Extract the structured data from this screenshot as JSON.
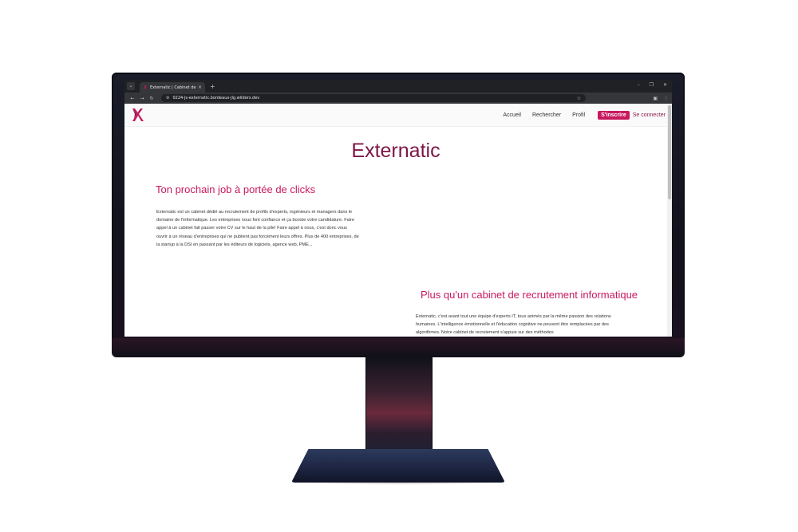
{
  "browser": {
    "tab_title": "Externatic | Cabinet de recrutement",
    "tab_close": "×",
    "new_tab": "+",
    "url": "0224-js-externatic.bordeaux-jlg.wilders.dev",
    "window_controls": [
      "–",
      "❐",
      "✕"
    ]
  },
  "site": {
    "nav": {
      "home": "Accueil",
      "search": "Rechercher",
      "profile": "Profil",
      "signup": "S'inscrire",
      "login": "Se connecter"
    },
    "hero_title": "Externatic",
    "section1": {
      "title": "Ton prochain job à portée de clicks",
      "text": "Externatic est un cabinet dédié au recrutement de profils d'experts, ingénieurs et managers dans le domaine de l'informatique. Les entreprises nous font confiance et ça booste votre candidature. Faire appel à un cabinet fait passer votre CV sur le haut de la pile! Faire appel à nous, c'est donc vous ouvrir à un réseau d'entreprises qui ne publient pas forcément leurs offres. Plus de 400 entreprises, de la startup à la DSI en passant par les éditeurs de logiciels, agence web, PME..."
    },
    "section2": {
      "title": "Plus qu'un cabinet de recrutement informatique",
      "text": "Externatic, c'est avant tout une équipe d'experts IT, tous animés par la même passion des relations humaines. L'intelligence émotionnelle et l'éducation cognitive ne peuvent être remplacées par des algorithmes. Notre cabinet de recrutement s'appuie sur des méthodes"
    }
  },
  "colors": {
    "brand_dark": "#7d1646",
    "brand_accent": "#c8195e"
  },
  "icons": [
    "menu-icon",
    "externatic-favicon",
    "back-icon",
    "forward-icon",
    "reload-icon",
    "site-info-icon",
    "star-icon",
    "extensions-icon",
    "more-icon",
    "externatic-logo"
  ]
}
